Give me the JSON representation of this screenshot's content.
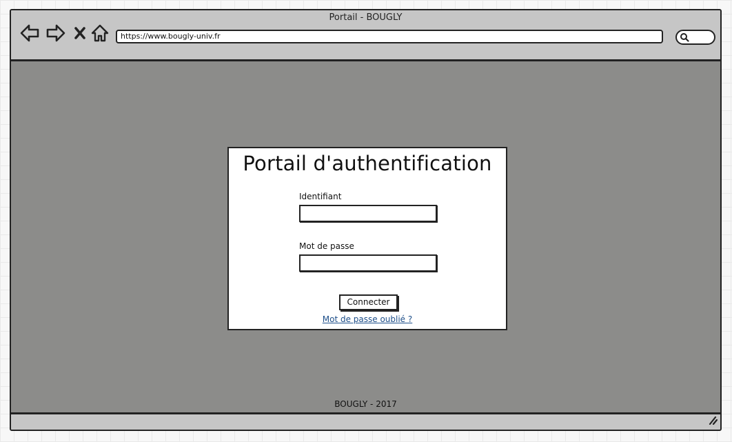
{
  "window": {
    "title": "Portail - BOUGLY",
    "url": "https://www.bougly-univ.fr"
  },
  "nav_icons": [
    "back-arrow-icon",
    "forward-arrow-icon",
    "close-x-icon",
    "home-icon",
    "search-icon"
  ],
  "login": {
    "title": "Portail d'authentification",
    "username_label": "Identifiant",
    "username_value": "",
    "password_label": "Mot de passe",
    "password_value": "",
    "submit_label": "Connecter",
    "forgot_link": "Mot de passe oublié ?"
  },
  "footer": {
    "text": "BOUGLY - 2017"
  },
  "colors": {
    "content_bg": "#8c8c8a",
    "chrome_bg": "#c6c6c6",
    "link": "#1e4f8a"
  }
}
